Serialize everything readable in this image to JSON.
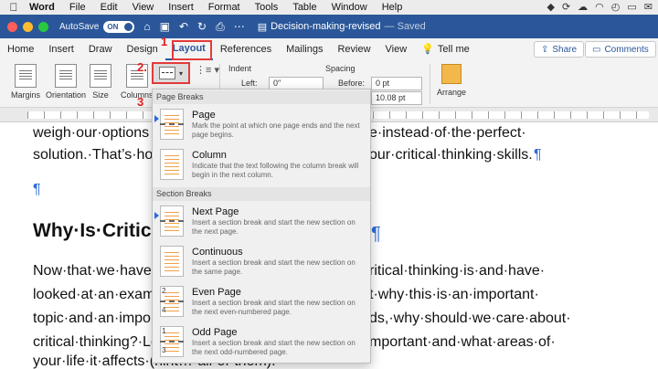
{
  "menubar": {
    "app": "Word",
    "items": [
      "File",
      "Edit",
      "View",
      "Insert",
      "Format",
      "Tools",
      "Table",
      "Window",
      "Help"
    ]
  },
  "titlebar": {
    "autosave_label": "AutoSave",
    "autosave_state": "ON",
    "doc_name": "Decision-making-revised",
    "saved_text": "— Saved"
  },
  "tabs": {
    "items": [
      "Home",
      "Insert",
      "Draw",
      "Design",
      "Layout",
      "References",
      "Mailings",
      "Review",
      "View"
    ],
    "active": "Layout",
    "tell_me": "Tell me",
    "share": "Share",
    "comments": "Comments"
  },
  "ribbon": {
    "margins": "Margins",
    "orientation": "Orientation",
    "size": "Size",
    "columns": "Columns",
    "indent_label": "Indent",
    "indent_left_label": "Left:",
    "indent_left_value": "0\"",
    "spacing_label": "Spacing",
    "before_label": "Before:",
    "before_value": "0 pt",
    "after_value": "10.08 pt",
    "arrange": "Arrange"
  },
  "annotations": {
    "step1": "1",
    "step2": "2.",
    "step3": "3"
  },
  "document": {
    "line1_left": "weigh·our·options",
    "line1_right": "e·instead·of·the·perfect·",
    "line2_left": "solution.·That’s·ho",
    "line2_right": "our·critical·thinking·skills.",
    "pilcrow": "¶",
    "heading": "Why·Is·Critic",
    "line3_left": "Now·that·we·have",
    "line3_right": "ritical·thinking·is·and·have·",
    "line4_left": "looked·at·an·exam",
    "line4_right": "t·why·this·is·an·important·",
    "line5_left": "topic·and·an·impo",
    "line5_right": "ds,·why·should·we·care·about·",
    "line6_left": "critical·thinking?·Le",
    "line6_right": "mportant·and·what·areas·of·",
    "line7_left": "your·life·it·affects·(hint…·all·of·them)."
  },
  "dropdown": {
    "page_breaks_header": "Page Breaks",
    "section_breaks_header": "Section Breaks",
    "items": [
      {
        "title": "Page",
        "desc": "Mark the point at which one page ends and the next page begins."
      },
      {
        "title": "Column",
        "desc": "Indicate that the text following the column break will begin in the next column."
      },
      {
        "title": "Next Page",
        "desc": "Insert a section break and start the new section on the next page."
      },
      {
        "title": "Continuous",
        "desc": "Insert a section break and start the new section on the same page."
      },
      {
        "title": "Even Page",
        "desc": "Insert a section break and start the new section on the next even-numbered page."
      },
      {
        "title": "Odd Page",
        "desc": "Insert a section break and start the new section on the next odd-numbered page."
      }
    ]
  },
  "colors": {
    "word_blue": "#2b579a",
    "annotation_red": "#e23b3b",
    "pilcrow_blue": "#2b6cd6"
  }
}
